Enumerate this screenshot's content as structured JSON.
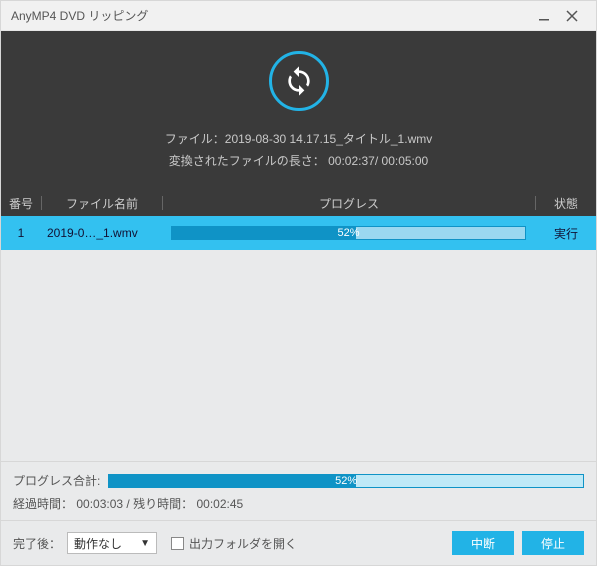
{
  "window": {
    "title": "AnyMP4 DVD リッピング"
  },
  "hero": {
    "file_label": "ファイル：",
    "file_name": "2019-08-30 14.17.15_タイトル_1.wmv",
    "length_label": "変換されたファイルの長さ：",
    "length_current": "00:02:37",
    "length_total": "00:05:00"
  },
  "columns": {
    "num": "番号",
    "name": "ファイル名前",
    "progress": "プログレス",
    "status": "状態"
  },
  "rows": [
    {
      "num": "1",
      "name": "2019-0…_1.wmv",
      "progress_pct": 52,
      "progress_label": "52%",
      "status": "実行"
    }
  ],
  "summary": {
    "total_label": "プログレス合計:",
    "total_pct": 52,
    "total_pct_label": "52%",
    "elapsed_label": "経過時間：",
    "elapsed": "00:03:03",
    "remain_label": "残り時間：",
    "remain": "00:02:45",
    "separator": " /"
  },
  "footer": {
    "after_label": "完了後：",
    "after_value": "動作なし",
    "open_folder_label": "出力フォルダを開く",
    "open_folder_checked": false,
    "btn_interrupt": "中断",
    "btn_stop": "停止"
  }
}
